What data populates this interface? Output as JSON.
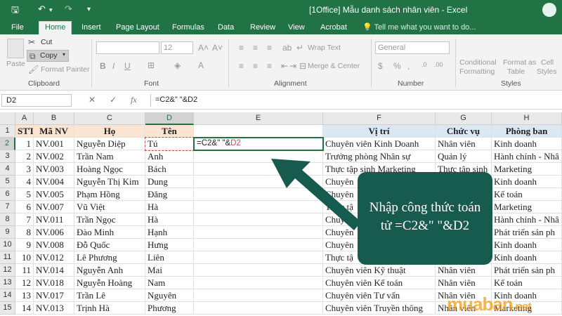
{
  "window": {
    "title": "[1Office] Mẫu danh sách nhân viên - Excel"
  },
  "ribbon_tabs": [
    "File",
    "Home",
    "Insert",
    "Page Layout",
    "Formulas",
    "Data",
    "Review",
    "View",
    "Acrobat"
  ],
  "active_tab": "Home",
  "tell_me": "Tell me what you want to do...",
  "clipboard": {
    "paste": "Paste",
    "cut": "Cut",
    "copy": "Copy",
    "format_painter": "Format Painter",
    "group": "Clipboard"
  },
  "font": {
    "size": "12",
    "group": "Font"
  },
  "alignment": {
    "wrap_text": "Wrap Text",
    "merge_center": "Merge & Center",
    "group": "Alignment"
  },
  "number": {
    "format": "General",
    "group": "Number"
  },
  "styles": {
    "conditional_1": "Conditional",
    "conditional_2": "Formatting",
    "format_table_1": "Format as",
    "format_table_2": "Table",
    "cell_styles_1": "Cell",
    "cell_styles_2": "Styles",
    "group": "Styles"
  },
  "formula_bar": {
    "name_box": "D2",
    "formula": "=C2&\" \"&D2"
  },
  "columns": [
    "A",
    "B",
    "C",
    "D",
    "E",
    "F",
    "G",
    "H"
  ],
  "headers": {
    "stt": "STT",
    "ma_nv": "Mã NV",
    "ho": "Họ",
    "ten": "Tên",
    "vi_tri": "Vị trí",
    "chuc_vu": "Chức vụ",
    "phong_ban": "Phòng ban"
  },
  "edit_cell": {
    "part1": "=C2&\" \"&",
    "part2": "D2"
  },
  "rows": [
    {
      "n": "2",
      "stt": "1",
      "ma": "NV.001",
      "ho": "Nguyễn Diệp",
      "ten": "Tú",
      "vt": "Chuyên viên Kinh Doanh",
      "cv": "Nhân viên",
      "pb": "Kinh doanh"
    },
    {
      "n": "3",
      "stt": "2",
      "ma": "NV.002",
      "ho": "Trần Nam",
      "ten": "Anh",
      "vt": "Trưởng phòng Nhân sự",
      "cv": "Quản lý",
      "pb": "Hành chính - Nhâ"
    },
    {
      "n": "4",
      "stt": "3",
      "ma": "NV.003",
      "ho": "Hoàng Ngọc",
      "ten": "Bách",
      "vt": "Thực tập sinh Marketing",
      "cv": "Thực tập sinh",
      "pb": "Marketing"
    },
    {
      "n": "5",
      "stt": "4",
      "ma": "NV.004",
      "ho": "Nguyễn Thị Kim",
      "ten": "Dung",
      "vt": "Chuyên",
      "cv": "",
      "pb": "Kinh doanh"
    },
    {
      "n": "6",
      "stt": "5",
      "ma": "NV.005",
      "ho": "Phạm Hồng",
      "ten": "Đăng",
      "vt": "Chuyên",
      "cv": "",
      "pb": "Kế toán"
    },
    {
      "n": "7",
      "stt": "6",
      "ma": "NV.007",
      "ho": "Vũ Việt",
      "ten": "Hà",
      "vt": "Thực tậ",
      "cv": "",
      "pb": "Marketing"
    },
    {
      "n": "8",
      "stt": "7",
      "ma": "NV.011",
      "ho": "Trần Ngọc",
      "ten": "Hà",
      "vt": "Chuyên",
      "cv": "",
      "pb": "Hành chính - Nhâ"
    },
    {
      "n": "9",
      "stt": "8",
      "ma": "NV.006",
      "ho": "Đào Minh",
      "ten": "Hạnh",
      "vt": "Chuyên",
      "cv": "",
      "pb": "Phát triển sản ph"
    },
    {
      "n": "10",
      "stt": "9",
      "ma": "NV.008",
      "ho": "Đỗ Quốc",
      "ten": "Hưng",
      "vt": "Chuyên",
      "cv": "",
      "pb": "Kinh doanh"
    },
    {
      "n": "11",
      "stt": "10",
      "ma": "NV.012",
      "ho": "Lê Phương",
      "ten": "Liên",
      "vt": "Thực tậ",
      "cv": "",
      "pb": "Kinh doanh"
    },
    {
      "n": "12",
      "stt": "11",
      "ma": "NV.014",
      "ho": "Nguyễn Anh",
      "ten": "Mai",
      "vt": "Chuyên viên Kỹ thuật",
      "cv": "Nhân viên",
      "pb": "Phát triển sản ph"
    },
    {
      "n": "13",
      "stt": "12",
      "ma": "NV.018",
      "ho": "Nguyễn Hoàng",
      "ten": "Nam",
      "vt": "Chuyên viên Kế toán",
      "cv": "Nhân viên",
      "pb": "Kế toán"
    },
    {
      "n": "14",
      "stt": "13",
      "ma": "NV.017",
      "ho": "Trần Lê",
      "ten": "Nguyên",
      "vt": "Chuyên viên Tư vấn",
      "cv": "Nhân viên",
      "pb": "Kinh doanh"
    },
    {
      "n": "15",
      "stt": "14",
      "ma": "NV.013",
      "ho": "Trịnh Hà",
      "ten": "Phương",
      "vt": "Chuyên viên Truyền thông",
      "cv": "Nhân viên",
      "pb": "Marketing"
    }
  ],
  "callout": {
    "line1": "Nhập công thức toán",
    "line2": "tử =C2&\" \"&D2"
  },
  "watermark": {
    "main": "muaban",
    "tld": ".net"
  },
  "colors": {
    "excel_green": "#217346",
    "callout_bg": "#175a4e",
    "header_blue": "#dbe8f4",
    "header_orange": "#fbe5d2",
    "ref_red": "#c0504d",
    "ref_blue": "#4472c4",
    "watermark": "#f39c12"
  },
  "icons": [
    "save-icon",
    "undo-icon",
    "redo-icon",
    "customize-icon",
    "account-icon",
    "lightbulb-icon",
    "paste-icon",
    "cut-icon",
    "copy-icon",
    "format-painter-icon",
    "cancel-icon",
    "enter-icon",
    "fx-icon"
  ]
}
